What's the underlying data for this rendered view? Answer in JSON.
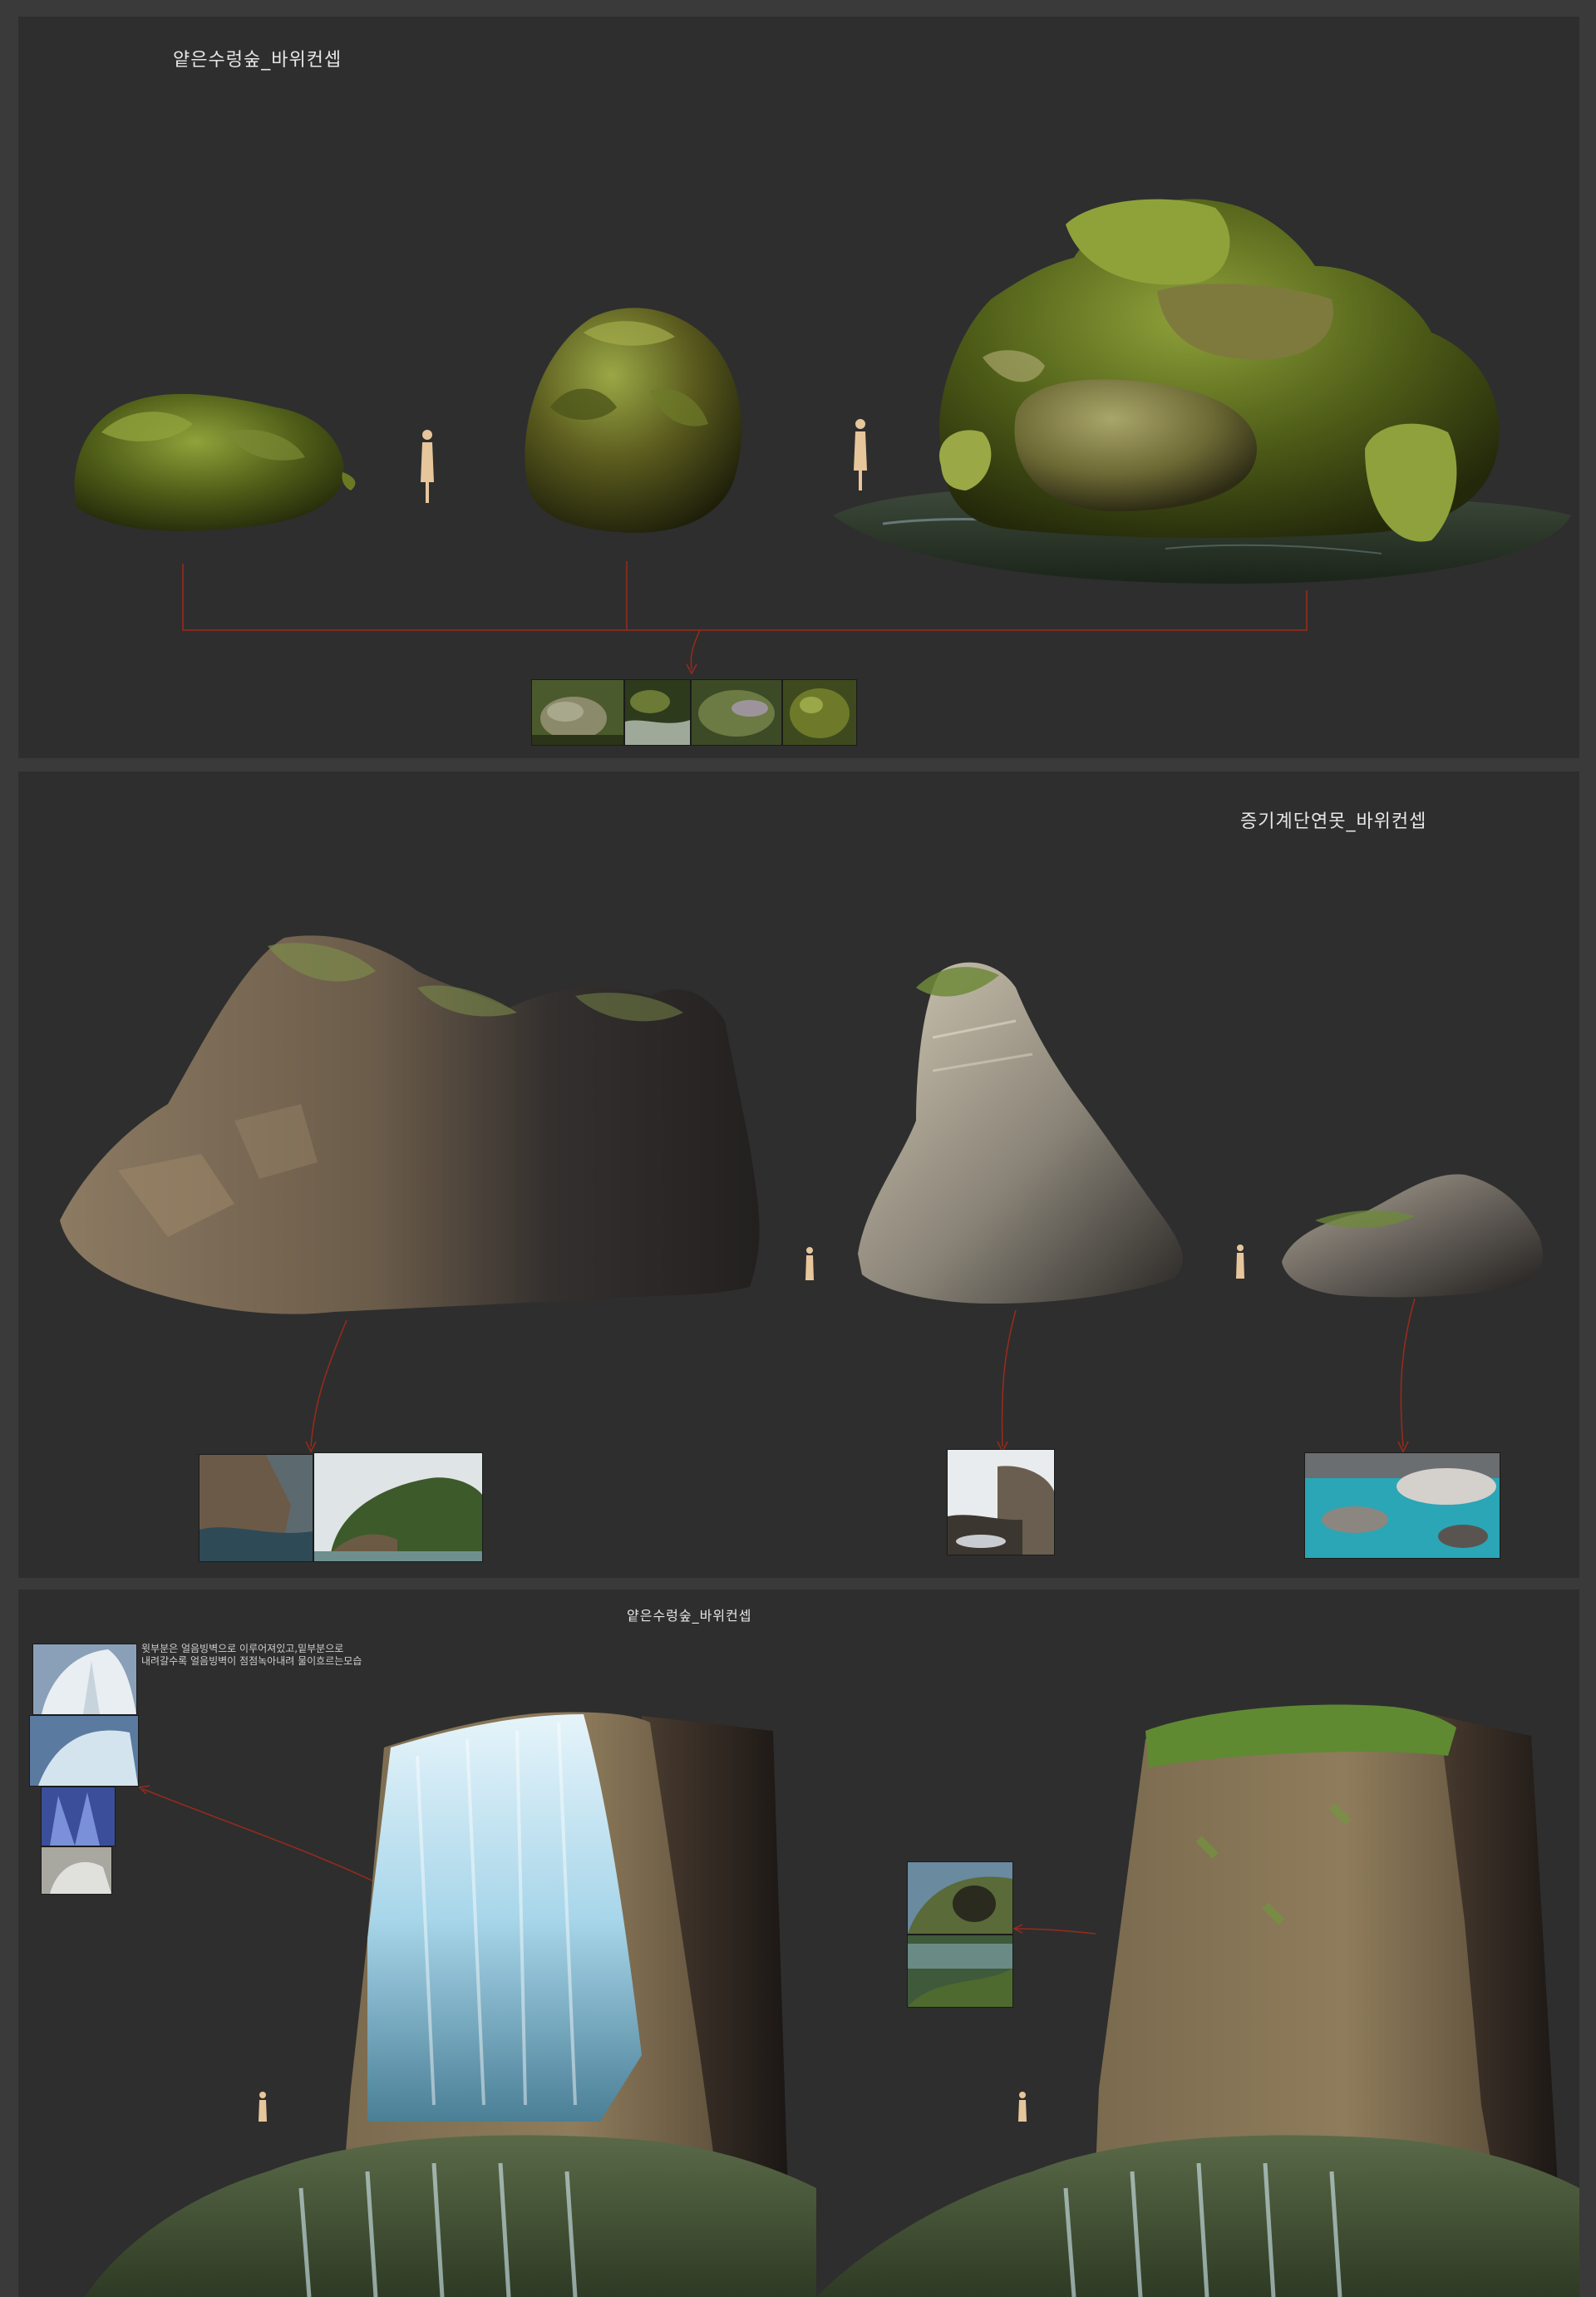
{
  "sections": [
    {
      "title": "얕은수렁숲_바위컨셉"
    },
    {
      "title": "증기계단연못_바위컨셉"
    },
    {
      "title": "얕은수렁숲_바위컨셉",
      "note": "윗부분은 얼음빙벽으로 이루어져있고,밑부분으로\n내려갈수록 얼음빙벽이 점점녹아내려 물이흐르는모습"
    }
  ],
  "colors": {
    "page_bg": "#3a3a3a",
    "panel_bg": "#2e2e2e",
    "connector": "#9a2a1c",
    "figure": "#e7c69c",
    "moss": "#6c7a1e",
    "rock": "#5a4a3a",
    "ice": "#bfe4f2"
  }
}
